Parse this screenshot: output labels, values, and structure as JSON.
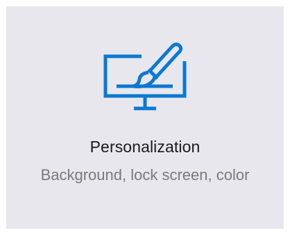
{
  "tile": {
    "title": "Personalization",
    "description": "Background, lock screen, color",
    "icon": "personalization-icon",
    "accent_color": "#0b78d3"
  }
}
